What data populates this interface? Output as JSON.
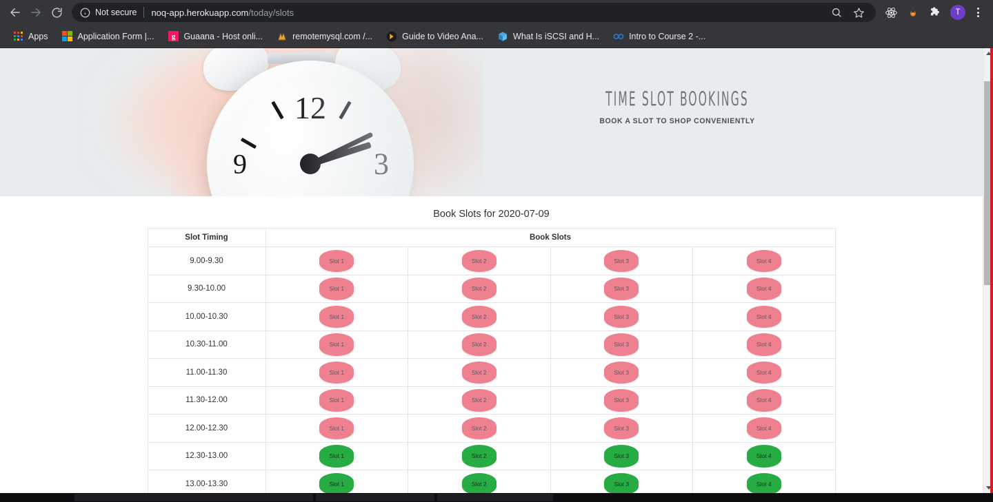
{
  "browser": {
    "nav": {
      "back_label": "Back",
      "forward_label": "Forward",
      "reload_label": "Reload"
    },
    "omnibox": {
      "security_text": "Not secure",
      "url_domain": "noq-app.herokuapp.com",
      "url_path": "/today/slots",
      "info_icon": "info-circle-icon",
      "search_icon": "search-icon",
      "star_icon": "star-bookmark-icon"
    },
    "toolbar_icons": [
      {
        "name": "react-devtools-icon",
        "glyph": "react"
      },
      {
        "name": "flame-extension-icon",
        "glyph": "flame"
      },
      {
        "name": "extensions-puzzle-icon",
        "glyph": "puzzle"
      }
    ],
    "profile": {
      "initial": "T",
      "color": "#6f3ec9"
    },
    "menu_label": "Customize and control Google Chrome",
    "bookmarks": [
      {
        "label": "Apps",
        "icon": "apps-grid-icon"
      },
      {
        "label": "Application Form |...",
        "icon": "microsoft-icon"
      },
      {
        "label": "Guaana - Host onli...",
        "icon": "guaana-g-icon"
      },
      {
        "label": "remotemysql.com /...",
        "icon": "remotemysql-icon"
      },
      {
        "label": "Guide to Video Ana...",
        "icon": "video-guide-icon"
      },
      {
        "label": "What Is iSCSI and H...",
        "icon": "iscsi-cube-icon"
      },
      {
        "label": "Intro to Course 2 -...",
        "icon": "coursera-icon"
      }
    ]
  },
  "hero": {
    "title": "TIME SLOT BOOKINGS",
    "subtitle": "BOOK A SLOT TO SHOP CONVENIENTLY",
    "image_alt": "hand-holding-alarm-clock-photo",
    "background_color": "#e7edef"
  },
  "main": {
    "heading": "Book Slots for 2020-07-09",
    "table": {
      "headers": {
        "time_column": "Slot Timing",
        "slots_column": "Book Slots"
      },
      "rows": [
        {
          "time": "9.00-9.30",
          "slots": [
            {
              "label": "Slot 1",
              "state": "booked"
            },
            {
              "label": "Slot 2",
              "state": "booked"
            },
            {
              "label": "Slot 3",
              "state": "booked"
            },
            {
              "label": "Slot 4",
              "state": "booked"
            }
          ]
        },
        {
          "time": "9.30-10.00",
          "slots": [
            {
              "label": "Slot 1",
              "state": "booked"
            },
            {
              "label": "Slot 2",
              "state": "booked"
            },
            {
              "label": "Slot 3",
              "state": "booked"
            },
            {
              "label": "Slot 4",
              "state": "booked"
            }
          ]
        },
        {
          "time": "10.00-10.30",
          "slots": [
            {
              "label": "Slot 1",
              "state": "booked"
            },
            {
              "label": "Slot 2",
              "state": "booked"
            },
            {
              "label": "Slot 3",
              "state": "booked"
            },
            {
              "label": "Slot 4",
              "state": "booked"
            }
          ]
        },
        {
          "time": "10.30-11.00",
          "slots": [
            {
              "label": "Slot 1",
              "state": "booked"
            },
            {
              "label": "Slot 2",
              "state": "booked"
            },
            {
              "label": "Slot 3",
              "state": "booked"
            },
            {
              "label": "Slot 4",
              "state": "booked"
            }
          ]
        },
        {
          "time": "11.00-11.30",
          "slots": [
            {
              "label": "Slot 1",
              "state": "booked"
            },
            {
              "label": "Slot 2",
              "state": "booked"
            },
            {
              "label": "Slot 3",
              "state": "booked"
            },
            {
              "label": "Slot 4",
              "state": "booked"
            }
          ]
        },
        {
          "time": "11.30-12.00",
          "slots": [
            {
              "label": "Slot 1",
              "state": "booked"
            },
            {
              "label": "Slot 2",
              "state": "booked"
            },
            {
              "label": "Slot 3",
              "state": "booked"
            },
            {
              "label": "Slot 4",
              "state": "booked"
            }
          ]
        },
        {
          "time": "12.00-12.30",
          "slots": [
            {
              "label": "Slot 1",
              "state": "booked"
            },
            {
              "label": "Slot 2",
              "state": "booked"
            },
            {
              "label": "Slot 3",
              "state": "booked"
            },
            {
              "label": "Slot 4",
              "state": "booked"
            }
          ]
        },
        {
          "time": "12.30-13.00",
          "slots": [
            {
              "label": "Slot 1",
              "state": "free"
            },
            {
              "label": "Slot 2",
              "state": "free"
            },
            {
              "label": "Slot 3",
              "state": "free"
            },
            {
              "label": "Slot 4",
              "state": "free"
            }
          ]
        },
        {
          "time": "13.00-13.30",
          "slots": [
            {
              "label": "Slot 1",
              "state": "free"
            },
            {
              "label": "Slot 2",
              "state": "free"
            },
            {
              "label": "Slot 3",
              "state": "free"
            },
            {
              "label": "Slot 4",
              "state": "free"
            }
          ]
        }
      ]
    }
  },
  "colors": {
    "booked": "#ef8090",
    "free": "#27ab43",
    "chrome_bg": "#35363a",
    "omnibox_bg": "#202124",
    "page_edge_red": "#d31d2b"
  }
}
